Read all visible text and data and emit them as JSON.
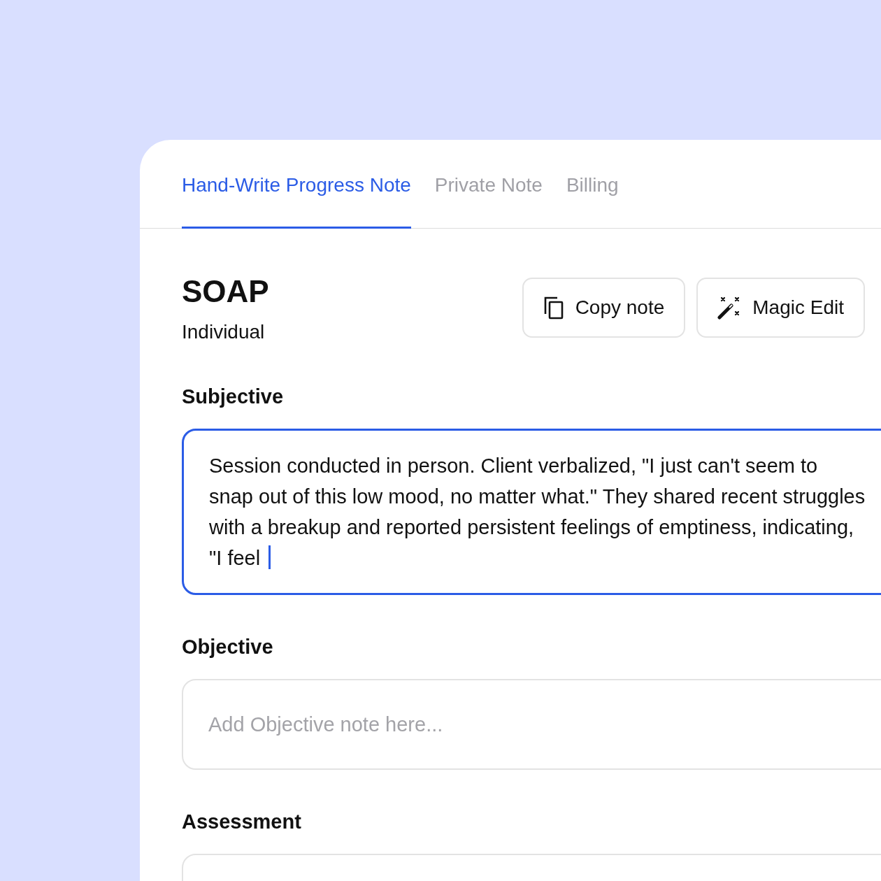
{
  "tabs": [
    {
      "label": "Hand-Write Progress Note",
      "selected": true
    },
    {
      "label": "Private Note",
      "selected": false
    },
    {
      "label": "Billing",
      "selected": false
    }
  ],
  "note": {
    "title": "SOAP",
    "subtitle": "Individual"
  },
  "actions": [
    {
      "label": "Copy note",
      "kind": "copy"
    },
    {
      "label": "Magic Edit",
      "kind": "magic"
    }
  ],
  "sections": [
    {
      "label": "Subjective",
      "value": "Session conducted in person. Client verbalized, \"I just can't seem to snap out of this low mood, no matter what.\" They shared recent struggles with a breakup and reported persistent feelings of emptiness, indicating, \"I feel",
      "focused": true
    },
    {
      "label": "Objective",
      "placeholder": "Add Objective note here...",
      "focused": false
    },
    {
      "label": "Assessment",
      "focused": false
    }
  ]
}
